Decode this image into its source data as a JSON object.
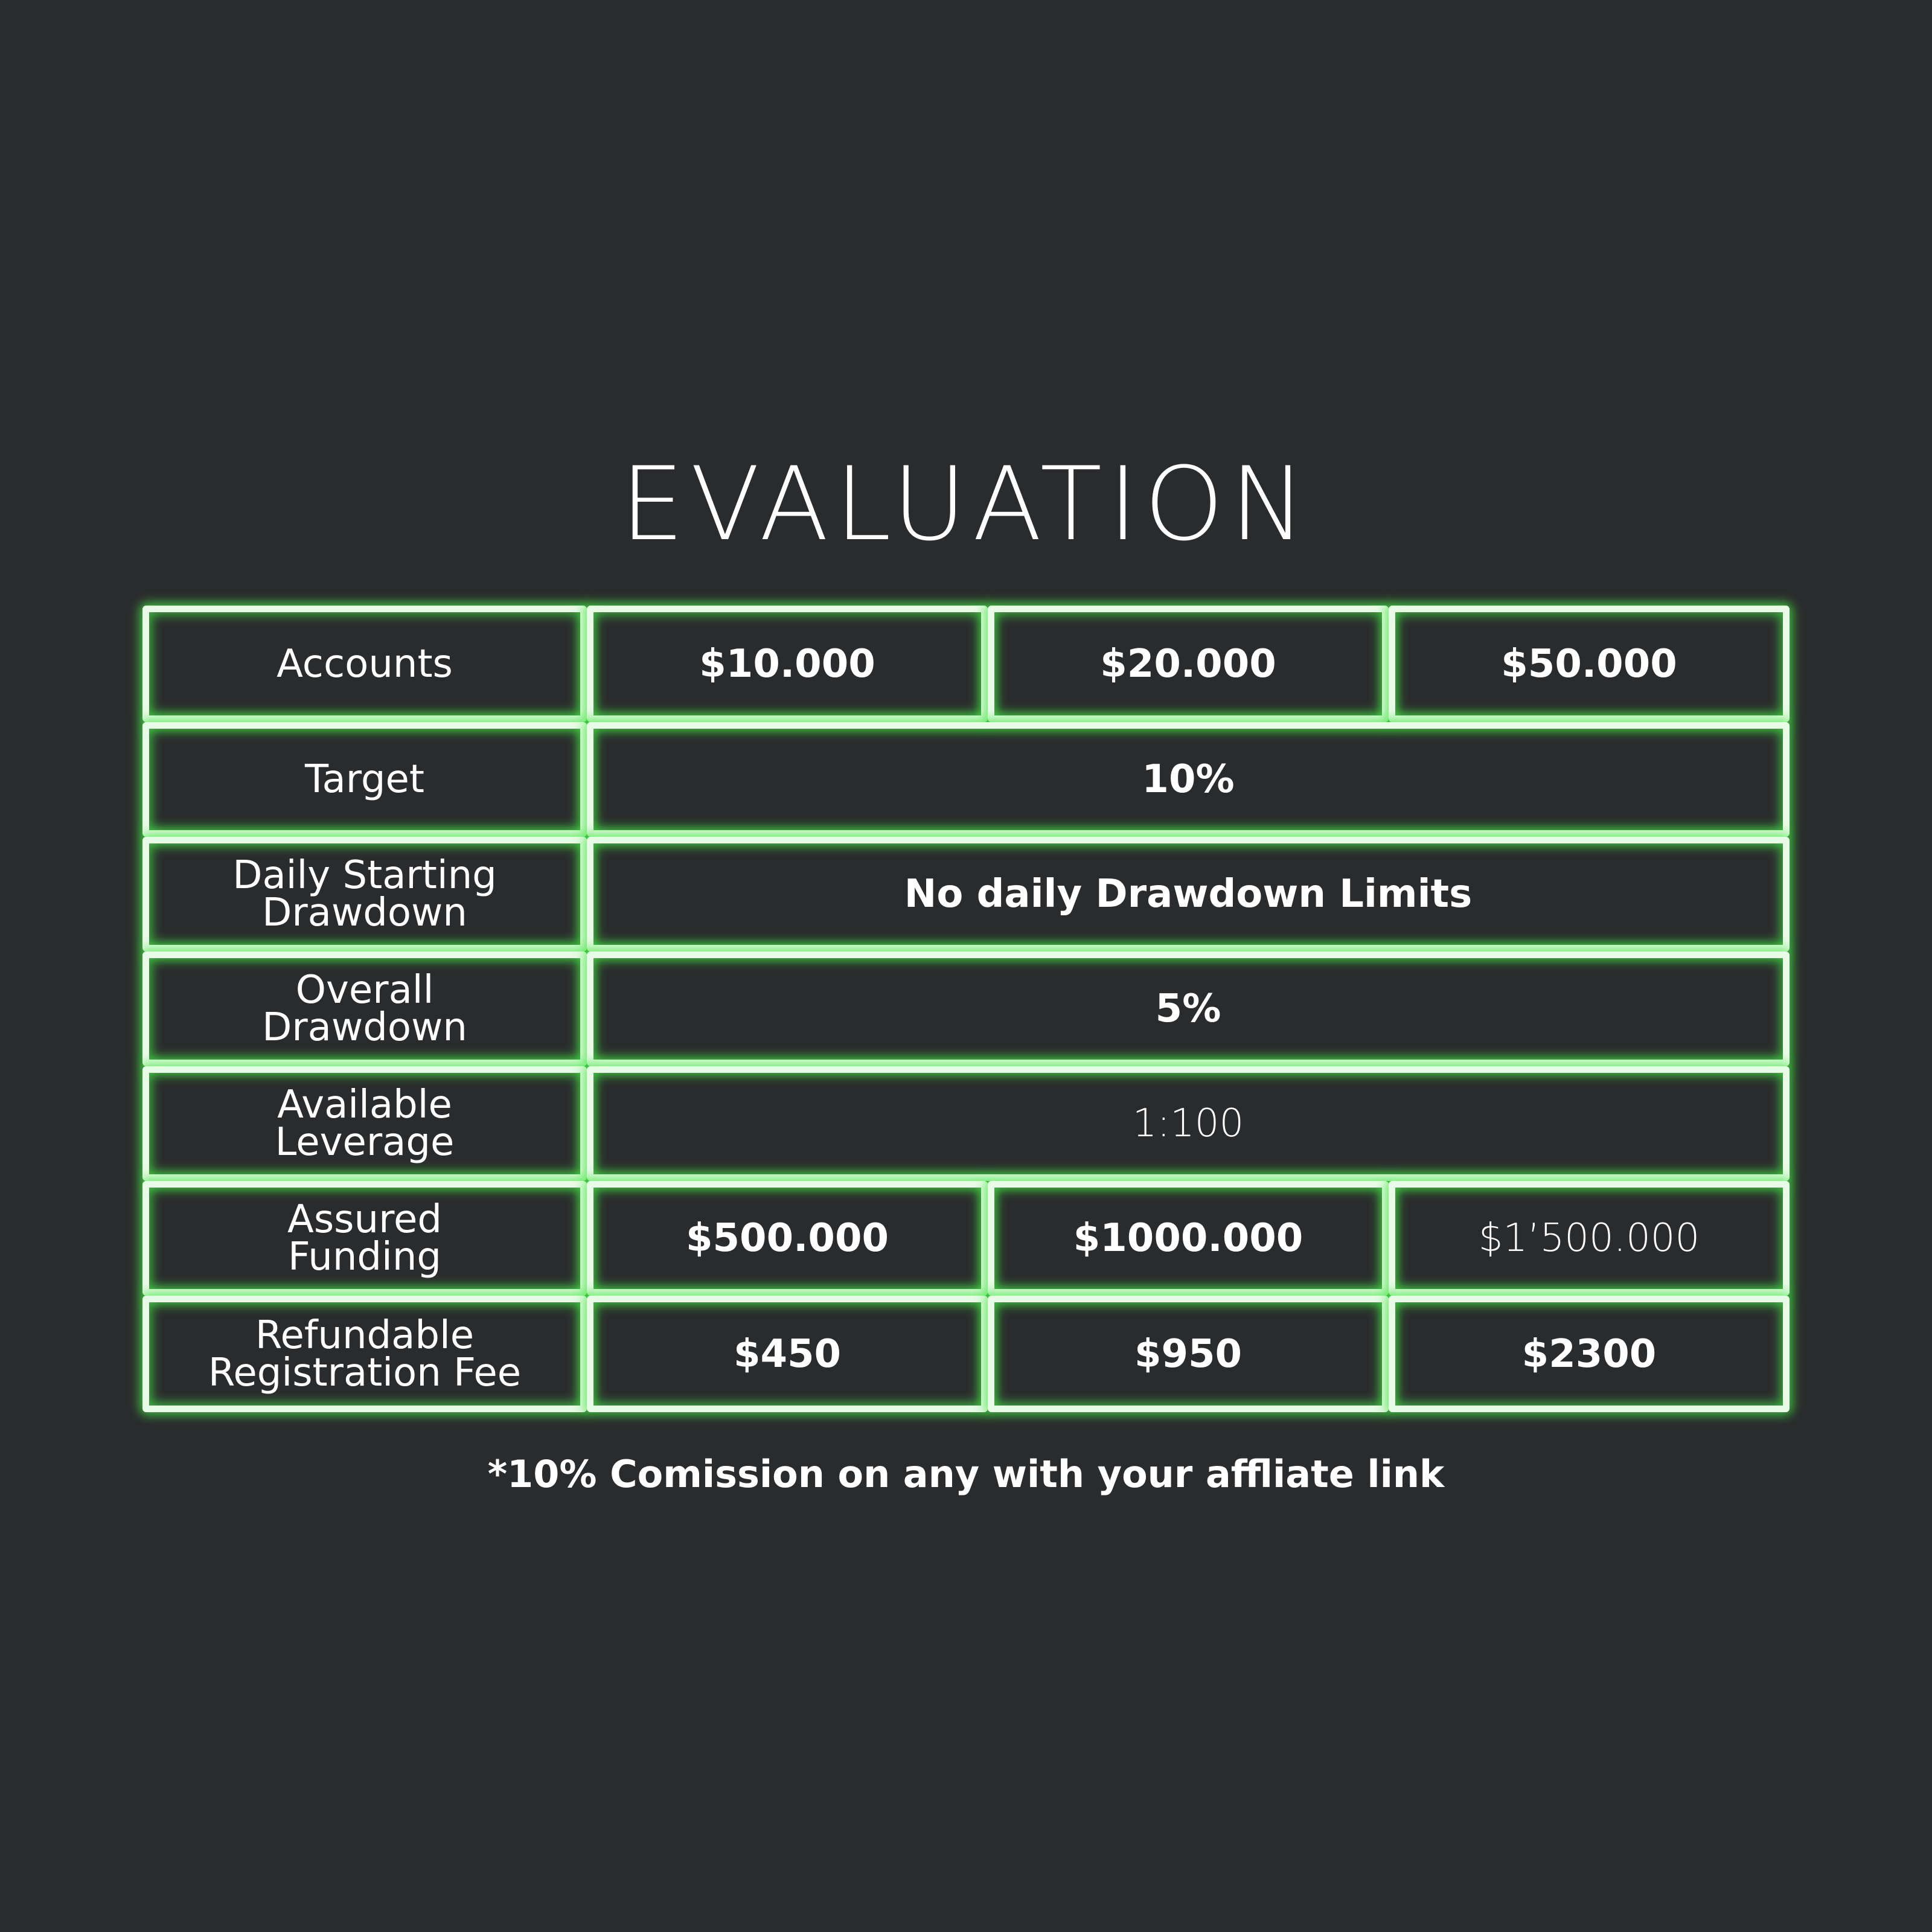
{
  "title": "EVALUATION",
  "rows": [
    {
      "label": "Accounts",
      "values": [
        "$10.000",
        "$20.000",
        "$50.000"
      ]
    },
    {
      "label": "Target",
      "value": "10%"
    },
    {
      "label": "Daily Starting\nDrawdown",
      "value": "No daily Drawdown Limits"
    },
    {
      "label": "Overall\nDrawdown",
      "value": "5%"
    },
    {
      "label": "Available\nLeverage",
      "value": "1:100"
    },
    {
      "label": "Assured\nFunding",
      "values": [
        "$500.000",
        "$1000.000",
        "$1’500.000"
      ]
    },
    {
      "label": "Refundable\nRegistration Fee",
      "values": [
        "$450",
        "$950",
        "$2300"
      ]
    }
  ],
  "footnote": "*10% Comission on any with your affliate link",
  "colors": {
    "background": "#2a2b2d",
    "border": "#e8fbe6",
    "glow": "#46e646",
    "text": "#ffffff"
  }
}
